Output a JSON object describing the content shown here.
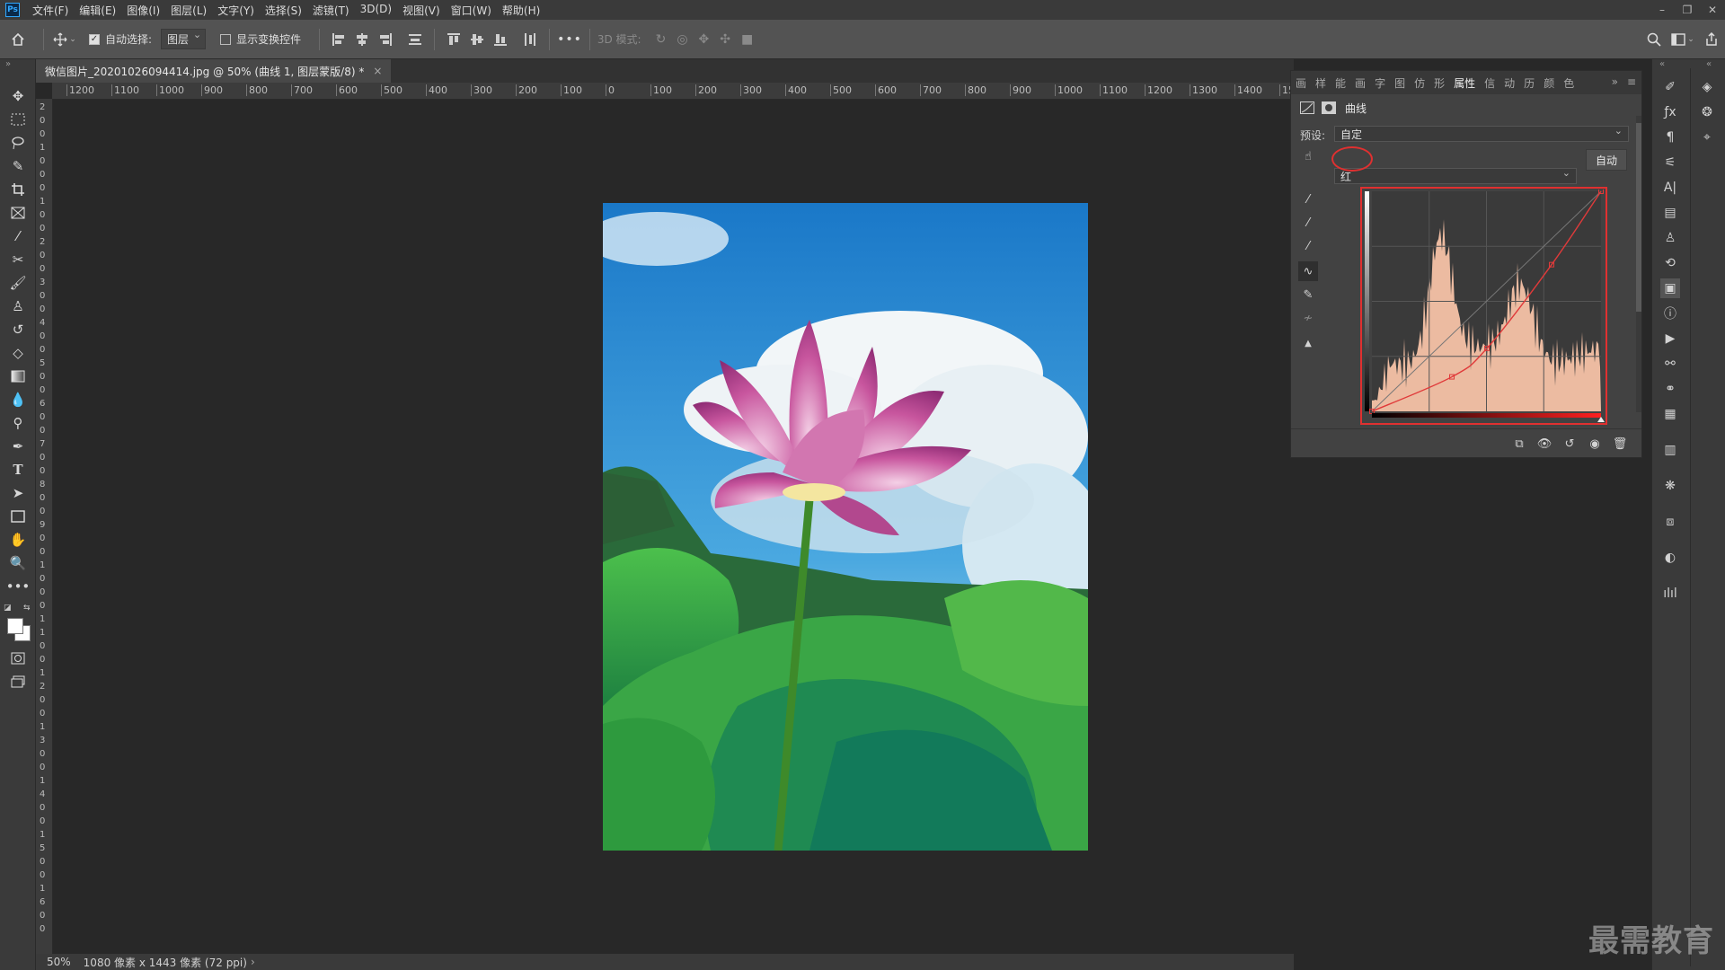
{
  "app": {
    "logo": "Ps"
  },
  "menu": [
    "文件(F)",
    "编辑(E)",
    "图像(I)",
    "图层(L)",
    "文字(Y)",
    "选择(S)",
    "滤镜(T)",
    "3D(D)",
    "视图(V)",
    "窗口(W)",
    "帮助(H)"
  ],
  "window_controls": {
    "minimize": "–",
    "restore": "❐",
    "close": "✕"
  },
  "options_bar": {
    "auto_select_label": "自动选择:",
    "auto_select_checked": true,
    "layer_dropdown": "图层",
    "show_transform_label": "显示变换控件",
    "show_transform_checked": false,
    "more": "•••",
    "mode_3d_label": "3D 模式:"
  },
  "document": {
    "tab_title": "微信图片_20201026094414.jpg @ 50% (曲线 1, 图层蒙版/8) *",
    "close": "×"
  },
  "ruler_top": [
    "1200",
    "1100",
    "1000",
    "900",
    "800",
    "700",
    "600",
    "500",
    "400",
    "300",
    "200",
    "100",
    "0",
    "100",
    "200",
    "300",
    "400",
    "500",
    "600",
    "700",
    "800",
    "900",
    "1000",
    "1100",
    "1200",
    "1300",
    "1400",
    "15"
  ],
  "ruler_left": [
    "2",
    "0",
    "0",
    "1",
    "0",
    "0",
    "0",
    "1",
    "0",
    "0",
    "2",
    "0",
    "0",
    "3",
    "0",
    "0",
    "4",
    "0",
    "0",
    "5",
    "0",
    "0",
    "6",
    "0",
    "0",
    "7",
    "0",
    "0",
    "8",
    "0",
    "0",
    "9",
    "0",
    "0",
    "1",
    "0",
    "0",
    "0",
    "1",
    "1",
    "0",
    "0",
    "1",
    "2",
    "0",
    "0",
    "1",
    "3",
    "0",
    "0",
    "1",
    "4",
    "0",
    "0",
    "1",
    "5",
    "0",
    "0",
    "1",
    "6",
    "0",
    "0"
  ],
  "status": {
    "zoom": "50%",
    "info": "1080 像素 x 1443 像素 (72 ppi)",
    "arrow": "›"
  },
  "panel": {
    "tabs": [
      "画",
      "样",
      "能",
      "画",
      "字",
      "图",
      "仿",
      "形",
      "属性",
      "信",
      "动",
      "历",
      "颜",
      "色"
    ],
    "active_tab": "属性",
    "collapse": "»",
    "menu": "≡",
    "adjustment_title": "曲线",
    "preset_label": "预设:",
    "preset_value": "自定",
    "channel_value": "红",
    "auto_button": "自动"
  },
  "curve": {
    "channel": "red",
    "input_range": [
      0,
      255
    ],
    "points": [
      [
        0,
        0
      ],
      [
        89,
        40
      ],
      [
        128,
        73
      ],
      [
        200,
        170
      ],
      [
        255,
        255
      ]
    ],
    "histogram_color": "#f6c2a6",
    "curve_color": "#e03a3a"
  },
  "watermark": "最需教育",
  "colors": {
    "highlight_red": "#e03030",
    "panel_bg": "#424242",
    "app_bg": "#282828"
  }
}
